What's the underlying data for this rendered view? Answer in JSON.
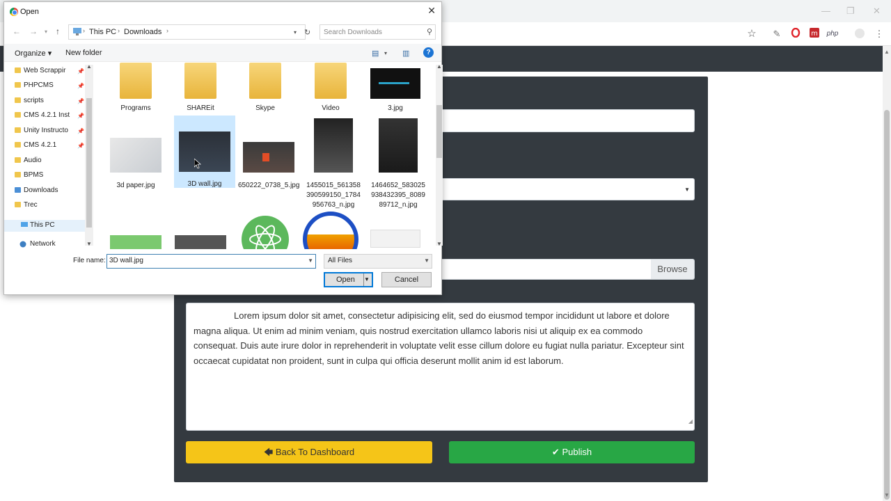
{
  "browser": {
    "window_controls": [
      "—",
      "❐",
      "✕"
    ],
    "toolbar_icons": [
      "star-icon",
      "eyedropper-icon",
      "opera-icon",
      "mega-icon",
      "php-icon",
      "profile-icon",
      "menu-icon"
    ],
    "php_label": "php"
  },
  "form": {
    "browse_label": "Browse",
    "post_body": "Lorem ipsum dolor sit amet, consectetur adipisicing elit, sed do eiusmod tempor incididunt ut labore et dolore magna aliqua. Ut enim ad minim veniam, quis nostrud exercitation ullamco laboris nisi ut aliquip ex ea commodo consequat. Duis aute irure dolor in reprehenderit in voluptate velit esse cillum dolore eu fugiat nulla pariatur. Excepteur sint occaecat cupidatat non proident, sunt in culpa qui officia deserunt mollit anim id est laborum.",
    "back_label": "Back To Dashboard",
    "publish_label": "Publish",
    "colors": {
      "card": "#343a40",
      "back": "#f5c518",
      "publish": "#28a745"
    }
  },
  "dialog": {
    "title": "Open",
    "breadcrumb": [
      "This PC",
      "Downloads"
    ],
    "search_placeholder": "Search Downloads",
    "organize_label": "Organize",
    "new_folder_label": "New folder",
    "help_label": "?",
    "nav_items": [
      {
        "label": "Web Scrappir",
        "pinned": true
      },
      {
        "label": "PHPCMS",
        "pinned": true
      },
      {
        "label": "scripts",
        "pinned": true
      },
      {
        "label": "CMS 4.2.1 Inst",
        "pinned": true
      },
      {
        "label": "Unity Instructo",
        "pinned": true
      },
      {
        "label": "CMS 4.2.1",
        "pinned": true
      },
      {
        "label": "Audio",
        "pinned": false
      },
      {
        "label": "BPMS",
        "pinned": false
      },
      {
        "label": "Downloads",
        "pinned": false
      },
      {
        "label": "Trec",
        "pinned": false
      },
      {
        "label": "This PC",
        "pinned": false
      },
      {
        "label": "Network",
        "pinned": false
      }
    ],
    "files": [
      {
        "name": "Programs",
        "kind": "folder"
      },
      {
        "name": "SHAREit",
        "kind": "folder"
      },
      {
        "name": "Skype",
        "kind": "folder"
      },
      {
        "name": "Video",
        "kind": "folder"
      },
      {
        "name": "3.jpg",
        "kind": "image"
      },
      {
        "name": "3d paper.jpg",
        "kind": "image"
      },
      {
        "name": "3D wall.jpg",
        "kind": "image",
        "selected": true
      },
      {
        "name": "650222_0738_5.jpg",
        "kind": "image"
      },
      {
        "name": "1455015_561358390599150_1784956763_n.jpg",
        "kind": "image"
      },
      {
        "name": "1464652_583025938432395_808989712_n.jpg",
        "kind": "image"
      },
      {
        "name": "",
        "kind": "image"
      },
      {
        "name": "",
        "kind": "image"
      },
      {
        "name": "",
        "kind": "image"
      },
      {
        "name": "",
        "kind": "image"
      },
      {
        "name": "",
        "kind": "image"
      }
    ],
    "file_name_label": "File name:",
    "file_name_value": "3D wall.jpg",
    "file_type_value": "All Files",
    "open_label": "Open",
    "cancel_label": "Cancel"
  }
}
